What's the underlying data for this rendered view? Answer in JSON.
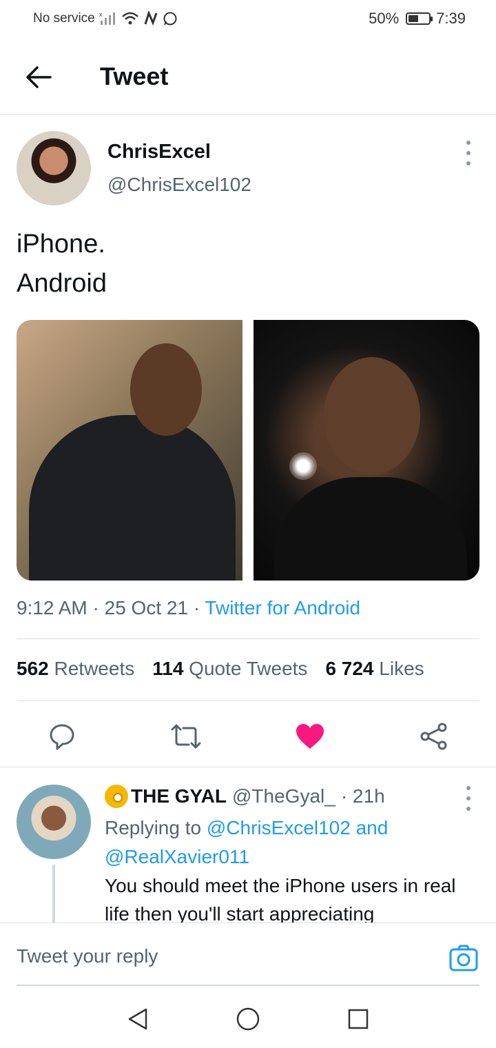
{
  "status_bar": {
    "carrier": "No service",
    "battery_percent": "50%",
    "battery_level": 0.5,
    "time": "7:39"
  },
  "header": {
    "title": "Tweet"
  },
  "tweet": {
    "author_name": "ChrisExcel",
    "author_handle": "@ChrisExcel102",
    "text_line1": "iPhone.",
    "text_line2": "Android",
    "time": "9:12 AM",
    "date": "25 Oct 21",
    "source": "Twitter for Android",
    "retweets": "562",
    "retweets_label": "Retweets",
    "quotes": "114",
    "quotes_label": "Quote Tweets",
    "likes": "6 724",
    "likes_label": "Likes"
  },
  "reply": {
    "name": "THE GYAL",
    "handle": "@TheGyal_",
    "age": "· 21h",
    "replying_prefix": "Replying to",
    "replying_to_1": "@ChrisExcel102 and",
    "replying_to_2": "@RealXavier011",
    "text": "You should meet the iPhone users in real life then you'll start appreciating"
  },
  "compose": {
    "placeholder": "Tweet your reply"
  },
  "colors": {
    "accent": "#1d9bf0",
    "like": "#f91880",
    "muted": "#536471",
    "text": "#0f1419"
  },
  "icons": [
    "back-arrow-icon",
    "more-vertical-icon",
    "reply-icon",
    "retweet-icon",
    "heart-icon",
    "share-icon",
    "camera-icon",
    "nav-back-icon",
    "nav-home-icon",
    "nav-recents-icon"
  ]
}
